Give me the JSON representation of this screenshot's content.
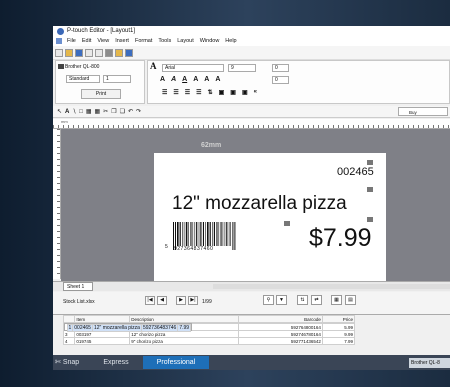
{
  "window": {
    "title": "P-touch Editor - [Layout1]"
  },
  "menu": [
    "File",
    "Edit",
    "View",
    "Insert",
    "Format",
    "Tools",
    "Layout",
    "Window",
    "Help"
  ],
  "printer_panel": {
    "printer_name": "Brother QL-800",
    "mode_value": "Standard",
    "copies_value": "1",
    "print_label": "Print"
  },
  "font_panel": {
    "font_name": "Arial",
    "font_size": "9",
    "spacing_value": "0",
    "line_spacing_value": "0"
  },
  "search": {
    "placeholder": "Buy"
  },
  "label": {
    "width_text": "62mm",
    "code": "002465",
    "description": "12\" mozzarella pizza",
    "price": "$7.99",
    "barcode_lead": "5",
    "barcode_digits": "927364837460"
  },
  "sheet": {
    "tab_label": "Sheet 1"
  },
  "database": {
    "file_name": "Stock List.xlsx",
    "record_count": "1/99",
    "columns": [
      "Item",
      "Description",
      "Barcode",
      "Price"
    ],
    "rows": [
      {
        "num": "1",
        "item": "002465",
        "description": "12\" mozzarella pizza",
        "barcode": "592736483746",
        "price": "7.99"
      },
      {
        "num": "2",
        "item": "002545",
        "description": "9\" mozzarella pizza",
        "barcode": "592764800164",
        "price": "5.99"
      },
      {
        "num": "3",
        "item": "003197",
        "description": "12\" chorizo pizza",
        "barcode": "592746780164",
        "price": "9.99"
      },
      {
        "num": "4",
        "item": "019745",
        "description": "9\" chorizo pizza",
        "barcode": "592771436542",
        "price": "7.99"
      }
    ]
  },
  "status": {
    "modes": [
      "Snap",
      "Express",
      "Professional"
    ],
    "printer": "Brother QL-8"
  },
  "colors": {
    "accent": "#1e6fb8",
    "canvas_bg": "#7f8087",
    "status_bg": "#3a4556"
  }
}
